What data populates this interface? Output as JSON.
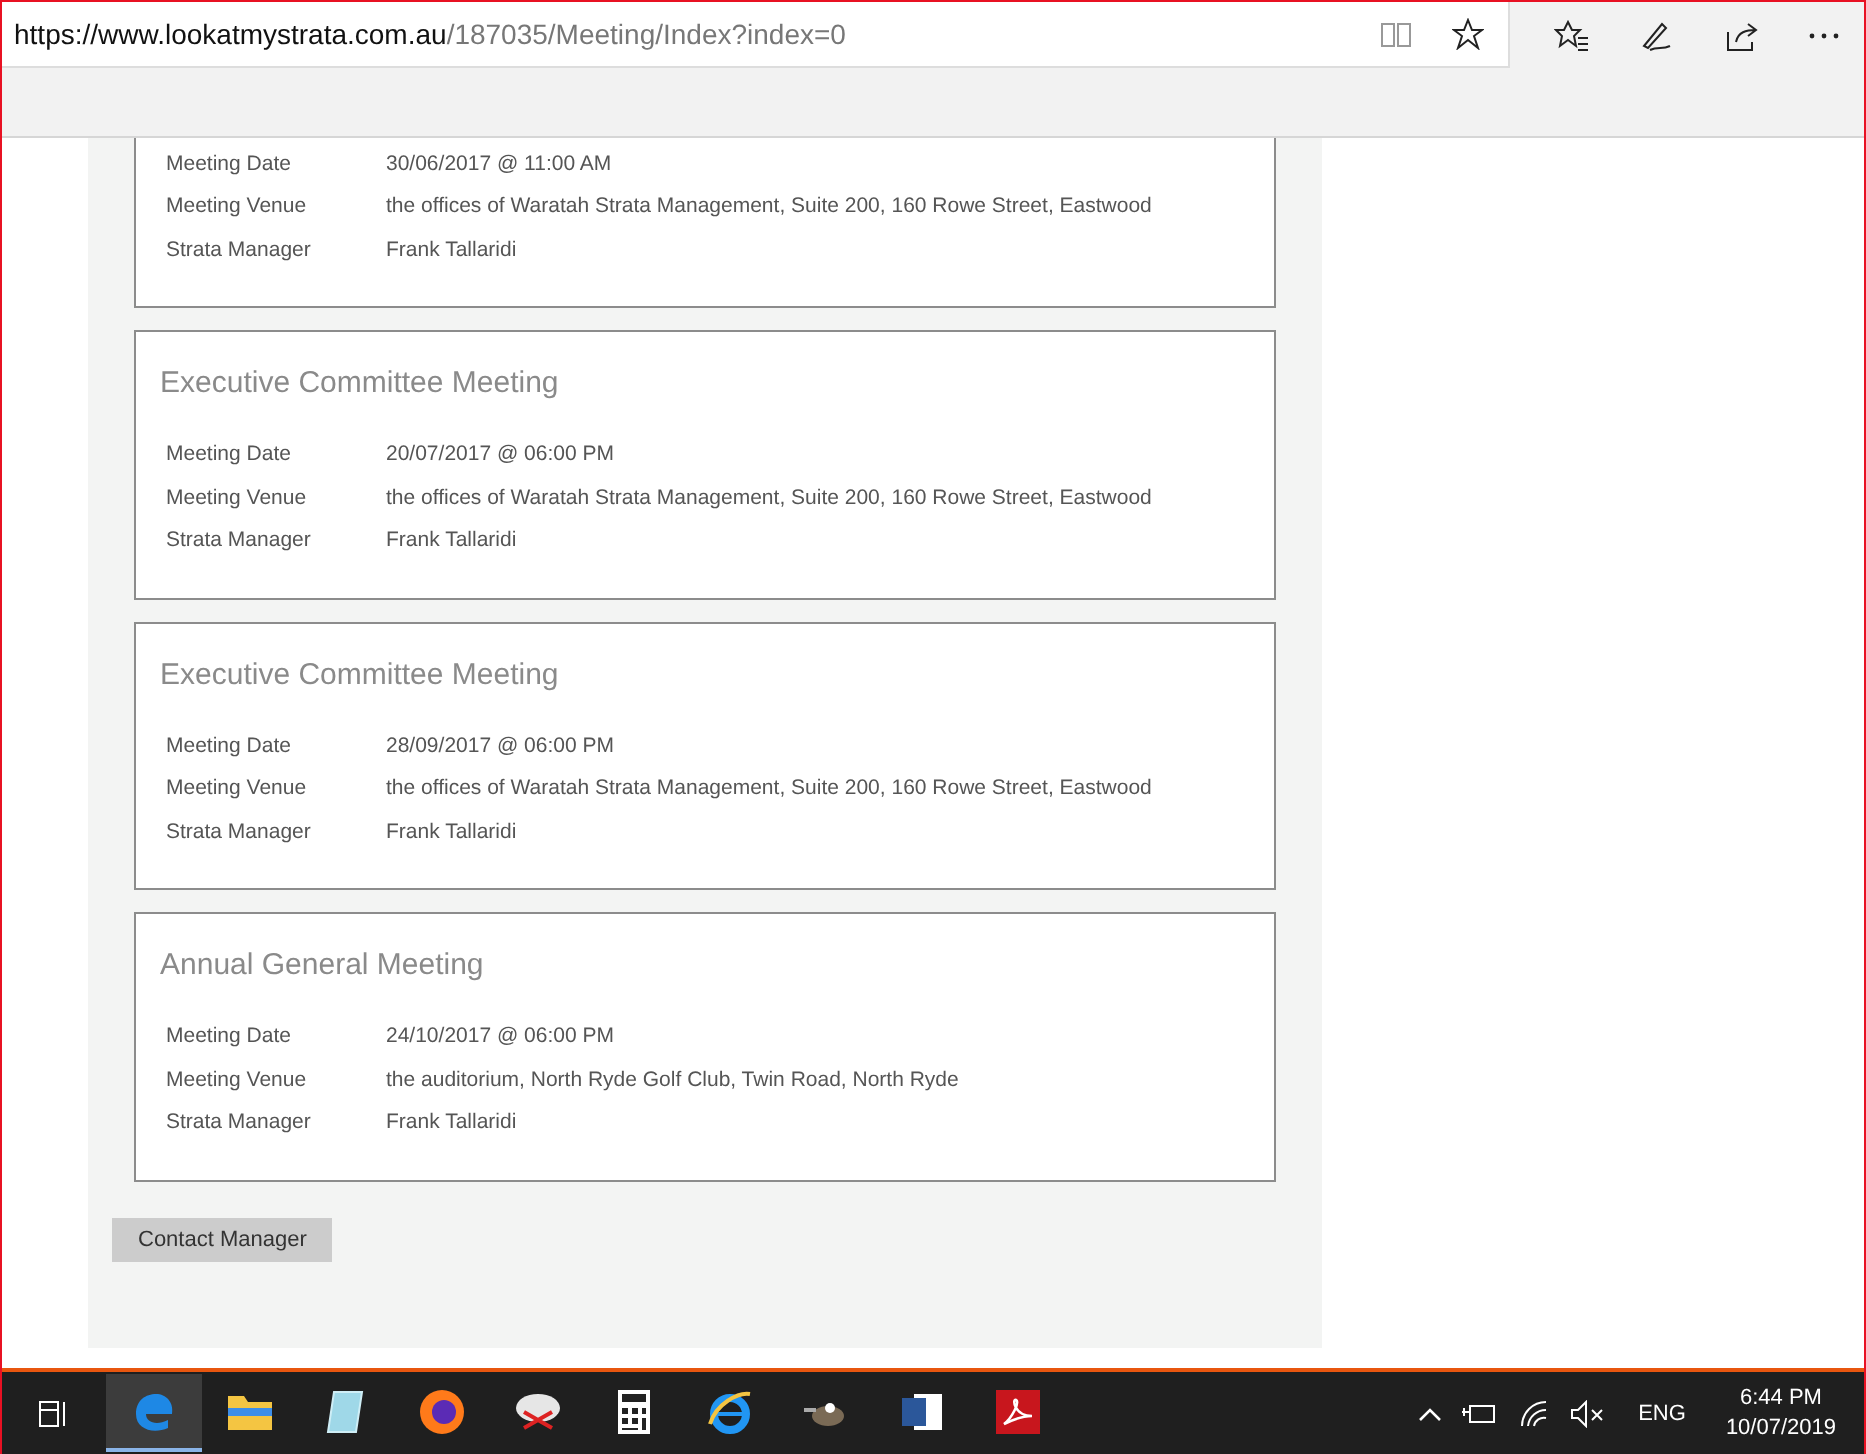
{
  "browser": {
    "url_host": "https://www.lookatmystrata.com.au",
    "url_path": "/187035/Meeting/Index?index=0"
  },
  "meetings": [
    {
      "rows": [
        {
          "label": "Meeting Date",
          "value": "30/06/2017 @ 11:00 AM"
        },
        {
          "label": "Meeting Venue",
          "value": "the offices of Waratah Strata Management, Suite 200, 160 Rowe Street, Eastwood"
        },
        {
          "label": "Strata Manager",
          "value": "Frank Tallaridi"
        }
      ]
    },
    {
      "title": "Executive Committee Meeting",
      "rows": [
        {
          "label": "Meeting Date",
          "value": "20/07/2017 @ 06:00 PM"
        },
        {
          "label": "Meeting Venue",
          "value": "the offices of Waratah Strata Management, Suite 200, 160 Rowe Street, Eastwood"
        },
        {
          "label": "Strata Manager",
          "value": "Frank Tallaridi"
        }
      ]
    },
    {
      "title": "Executive Committee Meeting",
      "rows": [
        {
          "label": "Meeting Date",
          "value": "28/09/2017 @ 06:00 PM"
        },
        {
          "label": "Meeting Venue",
          "value": "the offices of Waratah Strata Management, Suite 200, 160 Rowe Street, Eastwood"
        },
        {
          "label": "Strata Manager",
          "value": "Frank Tallaridi"
        }
      ]
    },
    {
      "title": "Annual General Meeting",
      "rows": [
        {
          "label": "Meeting Date",
          "value": "24/10/2017 @ 06:00 PM"
        },
        {
          "label": "Meeting Venue",
          "value": "the auditorium, North Ryde Golf Club, Twin Road, North Ryde"
        },
        {
          "label": "Strata Manager",
          "value": "Frank Tallaridi"
        }
      ]
    }
  ],
  "contact_button": "Contact Manager",
  "taskbar": {
    "apps": [
      {
        "kind": "edge",
        "selected": true
      },
      {
        "kind": "folder",
        "selected": false
      },
      {
        "kind": "notepad",
        "selected": false
      },
      {
        "kind": "firefox",
        "selected": false
      },
      {
        "kind": "snip",
        "selected": false
      },
      {
        "kind": "calculator",
        "selected": false
      },
      {
        "kind": "ie",
        "selected": false
      },
      {
        "kind": "gimp",
        "selected": false
      },
      {
        "kind": "word",
        "selected": false
      },
      {
        "kind": "pdf",
        "selected": false
      }
    ],
    "language": "ENG",
    "time": "6:44 PM",
    "date": "10/07/2019"
  }
}
